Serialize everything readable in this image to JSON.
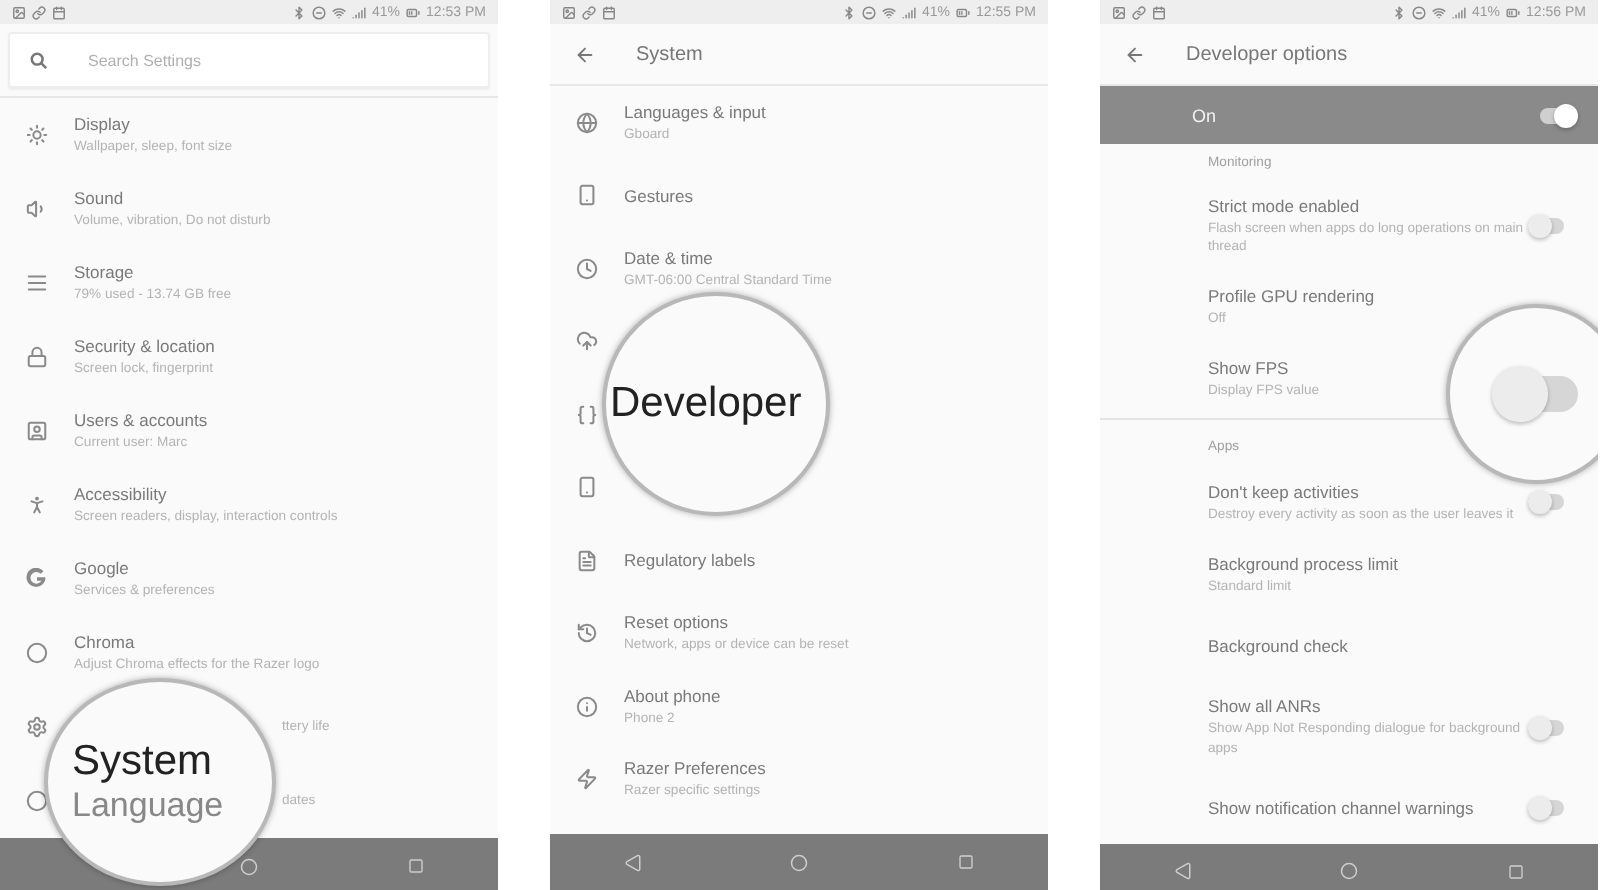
{
  "screens": [
    {
      "kind": "settings",
      "status": {
        "battery": "41%",
        "time": "12:53 PM"
      },
      "search": {
        "placeholder": "Search Settings"
      },
      "items": [
        {
          "title": "Display",
          "subtitle": "Wallpaper, sleep, font size"
        },
        {
          "title": "Sound",
          "subtitle": "Volume, vibration, Do not disturb"
        },
        {
          "title": "Storage",
          "subtitle": "79% used - 13.74 GB free"
        },
        {
          "title": "Security & location",
          "subtitle": "Screen lock, fingerprint"
        },
        {
          "title": "Users & accounts",
          "subtitle": "Current user: Marc"
        },
        {
          "title": "Accessibility",
          "subtitle": "Screen readers, display, interaction controls"
        },
        {
          "title": "Google",
          "subtitle": "Services & preferences"
        },
        {
          "title": "Chroma",
          "subtitle": "Adjust Chroma effects for the Razer logo"
        },
        {
          "kind": "covered",
          "subtitle": "ttery life"
        },
        {
          "kind": "covered",
          "subtitle": "dates"
        }
      ],
      "magnifier": {
        "kind": "text",
        "lines": [
          "System",
          "Language"
        ]
      }
    },
    {
      "kind": "system",
      "status": {
        "battery": "41%",
        "time": "12:55 PM"
      },
      "title": "System",
      "items": [
        {
          "title": "Languages & input",
          "subtitle": "Gboard"
        },
        {
          "title": "Gestures"
        },
        {
          "title": "Date & time",
          "subtitle": "GMT-06:00 Central Standard Time"
        },
        {
          "kind": "covered"
        },
        {
          "kind": "covered"
        },
        {
          "kind": "covered"
        },
        {
          "title": "Regulatory labels"
        },
        {
          "title": "Reset options",
          "subtitle": "Network, apps or device can be reset"
        },
        {
          "title": "About phone",
          "subtitle": "Phone 2"
        },
        {
          "title": "Razer Preferences",
          "subtitle": "Razer specific settings"
        }
      ],
      "magnifier": {
        "kind": "text",
        "lines": [
          "Developer"
        ]
      }
    },
    {
      "kind": "developer",
      "status": {
        "battery": "41%",
        "time": "12:56 PM"
      },
      "title": "Developer options",
      "master": {
        "label": "On",
        "on": true
      },
      "items": [
        {
          "kind": "header",
          "title": "Monitoring"
        },
        {
          "title": "Strict mode enabled",
          "subtitle": "Flash screen when apps do long operations on main thread",
          "on": false
        },
        {
          "title": "Profile GPU rendering",
          "subtitle": "Off"
        },
        {
          "title": "Show FPS",
          "subtitle": "Display FPS value"
        },
        {
          "kind": "divider"
        },
        {
          "kind": "header",
          "title": "Apps"
        },
        {
          "title": "Don't keep activities",
          "subtitle": "Destroy every activity as soon as the user leaves it",
          "on": false
        },
        {
          "title": "Background process limit",
          "subtitle": "Standard limit"
        },
        {
          "title": "Background check"
        },
        {
          "title": "Show all ANRs",
          "subtitle": "Show App Not Responding dialogue for background apps",
          "on": false
        },
        {
          "title": "Show notification channel warnings",
          "on": false
        }
      ],
      "magnifier": {
        "kind": "toggle",
        "on": false
      }
    }
  ]
}
